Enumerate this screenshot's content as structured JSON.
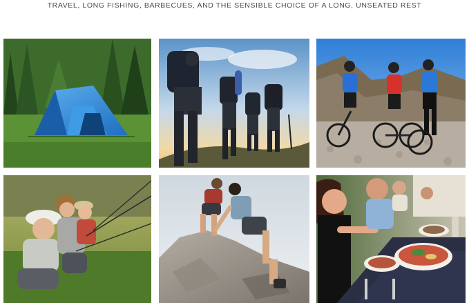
{
  "caption": "TRAVEL, LONG FISHING, BARBECUES, AND THE SENSIBLE CHOICE OF A LONG, UNSEATED REST",
  "photos": [
    {
      "subject": "tent-camping",
      "icon": "tent-icon"
    },
    {
      "subject": "hiking",
      "icon": "hikers-icon"
    },
    {
      "subject": "cycling",
      "icon": "bicycle-icon"
    },
    {
      "subject": "fishing",
      "icon": "fishing-rod-icon"
    },
    {
      "subject": "rock-climbing",
      "icon": "climber-icon"
    },
    {
      "subject": "outdoor-dining",
      "icon": "dining-icon"
    }
  ],
  "colors": {
    "grass": "#5f8f3a",
    "forest": "#2f5a26",
    "sky": "#4f8fd0",
    "tent": "#2e86d6",
    "rock": "#9b948a"
  }
}
